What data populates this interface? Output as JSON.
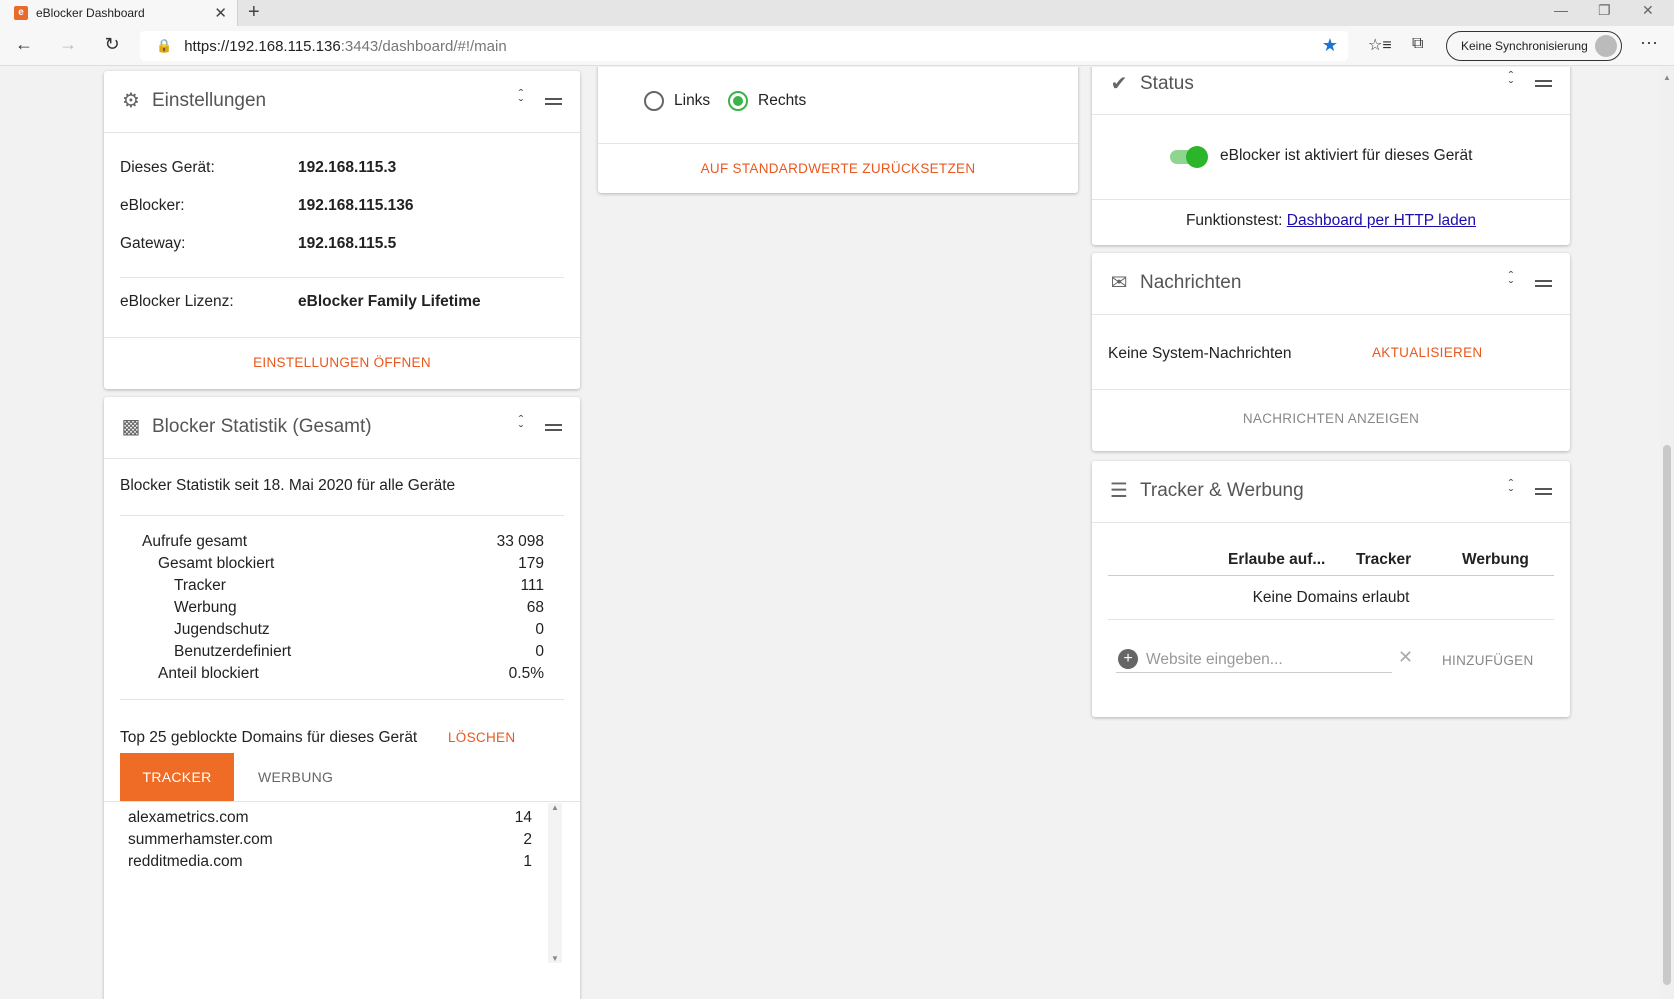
{
  "browser": {
    "tab_title": "eBlocker Dashboard",
    "tab_close": "✕",
    "new_tab": "+",
    "url_host": "https://192.168.115.136",
    "url_path": ":3443/dashboard/#!/main",
    "sync_label": "Keine Synchronisierung",
    "more": "···",
    "win_minimize": "—",
    "win_restore": "❐",
    "win_close": "✕"
  },
  "settings": {
    "title": "Einstellungen",
    "rows": [
      {
        "label": "Dieses Gerät:",
        "value": "192.168.115.3"
      },
      {
        "label": "eBlocker:",
        "value": "192.168.115.136"
      },
      {
        "label": "Gateway:",
        "value": "192.168.115.5"
      }
    ],
    "license_label": "eBlocker Lizenz:",
    "license_value": "eBlocker Family Lifetime",
    "open_button": "EINSTELLUNGEN ÖFFNEN"
  },
  "stats": {
    "title": "Blocker Statistik (Gesamt)",
    "since": "Blocker Statistik seit 18. Mai 2020 für alle Geräte",
    "rows": [
      {
        "label": "Aufrufe gesamt",
        "value": "33 098"
      },
      {
        "label": "Gesamt blockiert",
        "value": "179"
      },
      {
        "label": "Tracker",
        "value": "111"
      },
      {
        "label": "Werbung",
        "value": "68"
      },
      {
        "label": "Jugendschutz",
        "value": "0"
      },
      {
        "label": "Benutzerdefiniert",
        "value": "0"
      },
      {
        "label": "Anteil blockiert",
        "value": "0.5%"
      }
    ],
    "top_label": "Top 25 geblockte Domains für dieses Gerät",
    "clear_button": "LÖSCHEN",
    "tab_tracker": "TRACKER",
    "tab_werbung": "WERBUNG",
    "domains": [
      {
        "name": "alexametrics.com",
        "count": "14"
      },
      {
        "name": "summerhamster.com",
        "count": "2"
      },
      {
        "name": "redditmedia.com",
        "count": "1"
      }
    ]
  },
  "position": {
    "option_left": "Links",
    "option_right": "Rechts",
    "selected": "Rechts",
    "reset_button": "AUF STANDARDWERTE ZURÜCKSETZEN"
  },
  "status": {
    "title": "Status",
    "toggle_label": "eBlocker ist aktiviert für dieses Gerät",
    "test_prefix": "Funktionstest:",
    "test_link": "Dashboard per HTTP laden"
  },
  "messages": {
    "title": "Nachrichten",
    "empty": "Keine System-Nachrichten",
    "refresh_button": "AKTUALISIEREN",
    "show_button": "NACHRICHTEN ANZEIGEN"
  },
  "tracker_ads": {
    "title": "Tracker & Werbung",
    "col_allow": "Erlaube auf...",
    "col_tracker": "Tracker",
    "col_ads": "Werbung",
    "empty": "Keine Domains erlaubt",
    "input_placeholder": "Website eingeben...",
    "add_button": "HINZUFÜGEN"
  },
  "colors": {
    "accent": "#e8581f",
    "tab_active": "#ee6c26",
    "toggle_on": "#2bb52b",
    "star": "#1a73d9"
  }
}
